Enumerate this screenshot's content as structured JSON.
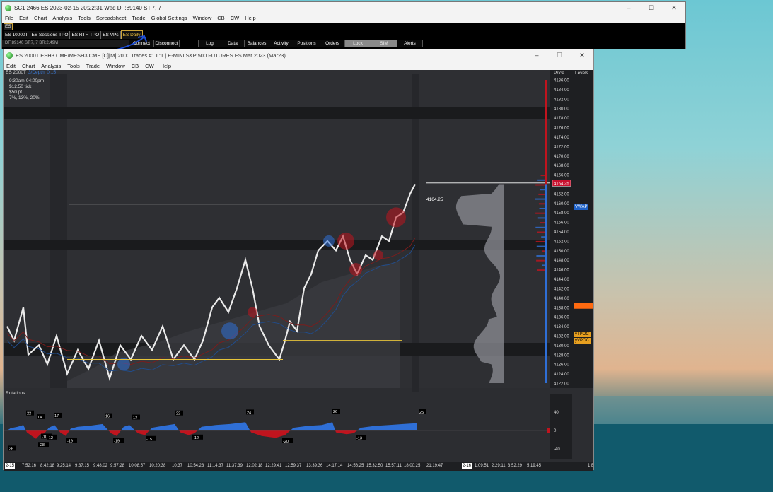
{
  "main_window": {
    "title": "SC1 2466 ES  2023-02-15  20:22:31 Wed  DF:89140  ST:7, 7",
    "menu": [
      "File",
      "Edit",
      "Chart",
      "Analysis",
      "Tools",
      "Spreadsheet",
      "Trade",
      "Global Settings",
      "Window",
      "CB",
      "CW",
      "Help"
    ],
    "symbol_box": "ES",
    "chartbook_tabs": [
      "ES 10000T",
      "ES Sessions TPO",
      "ES RTH TPO",
      "ES VPs",
      "ES Daily"
    ],
    "active_tab": "ES Daily",
    "account_status": "DF:89140  ST:7, 7  BR:2.49M",
    "toolbar_buttons": [
      "Connect",
      "Disconnect",
      "Log",
      "Data",
      "Balances",
      "Activity",
      "Positions",
      "Orders",
      "Lock",
      "SIM",
      "Alerts"
    ]
  },
  "chart_window": {
    "title": "ES 2000T  ESH3.CME/MESH3.CME  [C][M]  2000 Trades  #1 L:1 | E-MINI S&P 500 FUTURES ES Mar 2023 (Mar23)",
    "menu": [
      "Edit",
      "Chart",
      "Analysis",
      "Tools",
      "Trade",
      "Window",
      "CB",
      "CW",
      "Help"
    ],
    "chart_name": "ES 2000T",
    "chart_sub": "3/Depth, 0.15",
    "info_lines": [
      "9:30am-04:00pm",
      "$12.50 tick",
      "$50 pt",
      "7%, 13%, 20%"
    ],
    "price_axis_title": "Price",
    "levels_title": "Levels",
    "rotations_label": "Rotations",
    "last_price_label": "4164.25",
    "price_ticks": [
      "4186.00",
      "4184.00",
      "4182.00",
      "4180.00",
      "4178.00",
      "4176.00",
      "4174.00",
      "4172.00",
      "4170.00",
      "4168.00",
      "4166.00",
      "4164.00",
      "4162.00",
      "4160.00",
      "4158.00",
      "4156.00",
      "4154.00",
      "4152.00",
      "4150.00",
      "4148.00",
      "4146.00",
      "4144.00",
      "4142.00",
      "4140.00",
      "4138.00",
      "4136.00",
      "4134.00",
      "4132.00",
      "4130.00",
      "4128.00",
      "4126.00",
      "4124.00",
      "4122.00"
    ],
    "current_price_tag": "4164.25",
    "rotation_axis": [
      "40",
      "0",
      "-40"
    ],
    "level_labels": [
      {
        "text": "VWAP",
        "color": "#1f62c9",
        "price": 4159.2
      },
      {
        "text": "yTPOC",
        "color": "#e8a020",
        "price": 4132.3
      },
      {
        "text": "yVPOC",
        "color": "#e8a020",
        "price": 4131.0
      }
    ],
    "rotation_values": [
      "22",
      "14",
      "17",
      "-10",
      "-12",
      "-19",
      "16",
      "-19",
      "13",
      "-15",
      "22",
      "-12",
      "24",
      "-20",
      "26",
      "-13",
      "25",
      "36",
      "-28"
    ],
    "time_labels": [
      "7:52:16",
      "8:42:18",
      "9:25:14",
      "9:37:15",
      "9:48:02",
      "9:57:28",
      "10:08:57",
      "10:20:38",
      "10:37",
      "10:54:23",
      "11:14:37",
      "11:37:39",
      "12:02:18",
      "12:29:41",
      "12:59:37",
      "13:39:36",
      "14:17:14",
      "14:56:25",
      "15:32:50",
      "15:57:11",
      "18:00:25",
      "21:19:47",
      "1:09:51",
      "2:29:11",
      "3:52:29",
      "5:19:45"
    ],
    "time_marker_left": "2-15",
    "time_marker_mid": "2-16",
    "time_right": "1 E",
    "colors": {
      "bull": "#2f6fd6",
      "bear": "#c0141e",
      "yellow": "#e6c43a",
      "orange": "#ff6a10",
      "vwap": "#1f62c9"
    }
  }
}
